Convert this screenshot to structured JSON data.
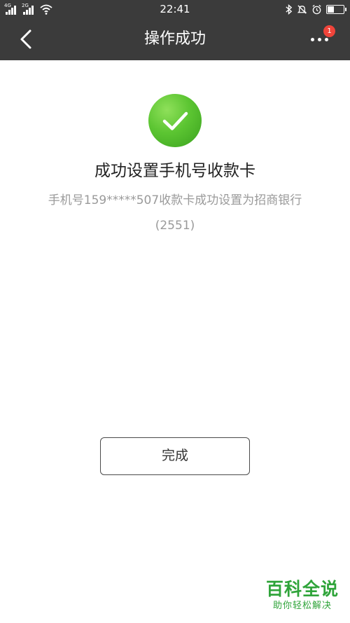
{
  "status_bar": {
    "time": "22:41",
    "signal_1_tag": "4G",
    "signal_2_tag": "2G",
    "icons": [
      "signal-icon",
      "signal-icon",
      "wifi-icon",
      "bluetooth-icon",
      "bell-off-icon",
      "alarm-icon",
      "battery-icon"
    ]
  },
  "nav": {
    "title": "操作成功",
    "badge_count": "1",
    "icons": [
      "chevron-left-icon",
      "more-icon"
    ]
  },
  "result": {
    "title": "成功设置手机号收款卡",
    "description_line1": "手机号159*****507收款卡成功设置为招商银行",
    "description_line2": "(2551)"
  },
  "actions": {
    "done_label": "完成"
  },
  "watermark": {
    "main": "百科全说",
    "sub": "助你轻松解决"
  },
  "colors": {
    "header_bg": "#3b3b3b",
    "success_green": "#5cc532",
    "badge_red": "#f0443a",
    "watermark_green": "#2fa43a"
  }
}
